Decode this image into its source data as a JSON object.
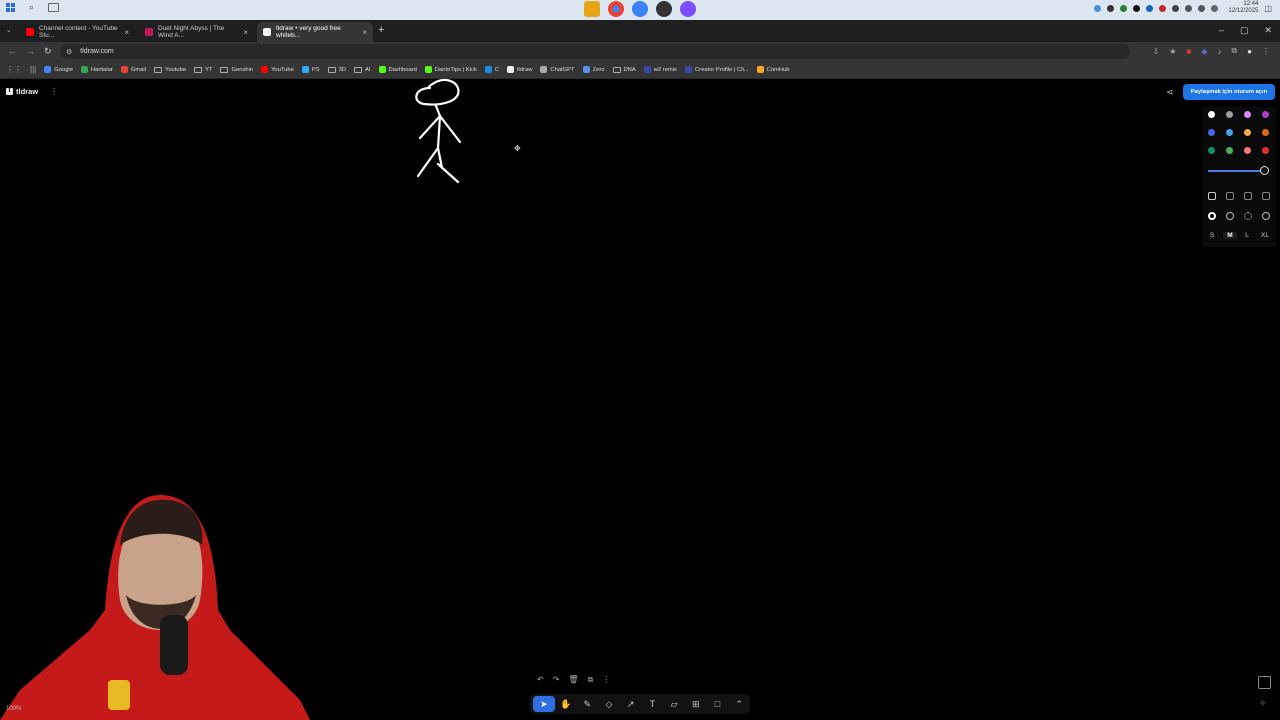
{
  "taskbar": {
    "clock_time": "12:44",
    "clock_date": "12/12/2025",
    "app_colors": [
      "#e8a317",
      "#dd4b39",
      "#3b82f6",
      "#444",
      "#7c4dff"
    ]
  },
  "tabs": [
    {
      "title": "Channel content - YouTube Stu...",
      "favicon_color": "#ff0000",
      "active": false
    },
    {
      "title": "Duet Night Abyss | The Wind A...",
      "favicon_color": "#c2185b",
      "active": false
    },
    {
      "title": "tldraw • very good free whiteb...",
      "favicon_color": "#eeeeee",
      "active": true
    }
  ],
  "address": {
    "url": "tldraw.com"
  },
  "bookmarks": [
    {
      "label": "Google",
      "icon": "google-icon",
      "color": "#4285f4"
    },
    {
      "label": "Haritalar",
      "icon": "maps-icon",
      "color": "#34a853"
    },
    {
      "label": "Gmail",
      "icon": "gmail-icon",
      "color": "#ea4335"
    },
    {
      "label": "Youtube",
      "icon": "folder-icon",
      "color": ""
    },
    {
      "label": "YT",
      "icon": "folder-icon",
      "color": ""
    },
    {
      "label": "Genshin",
      "icon": "folder-icon",
      "color": ""
    },
    {
      "label": "YouTube",
      "icon": "youtube-icon",
      "color": "#ff0000"
    },
    {
      "label": "PS",
      "icon": "ps-icon",
      "color": "#31a8ff"
    },
    {
      "label": "3D",
      "icon": "folder-icon",
      "color": ""
    },
    {
      "label": "AI",
      "icon": "folder-icon",
      "color": ""
    },
    {
      "label": "Dashboard",
      "icon": "kick-icon",
      "color": "#53fc18"
    },
    {
      "label": "DanteTips | Kick",
      "icon": "kick-icon",
      "color": "#53fc18"
    },
    {
      "label": "C",
      "icon": "c-icon",
      "color": "#1e88e5"
    },
    {
      "label": "tldraw",
      "icon": "tldraw-icon",
      "color": "#eeeeee"
    },
    {
      "label": "ChatGPT",
      "icon": "chatgpt-icon",
      "color": "#aaaaaa"
    },
    {
      "label": "Zero",
      "icon": "zero-icon",
      "color": "#5b8def"
    },
    {
      "label": "DNA",
      "icon": "folder-icon",
      "color": ""
    },
    {
      "label": "w2 remix",
      "icon": "w2-icon",
      "color": "#3949ab"
    },
    {
      "label": "Creator Profile | Cli...",
      "icon": "creator-icon",
      "color": "#3949ab"
    },
    {
      "label": "ComHub",
      "icon": "comhub-icon",
      "color": "#f9a825"
    }
  ],
  "tldraw": {
    "brand": "tldraw",
    "signin_label": "Paylaşmak için oturum açın",
    "colors": [
      "#ffffff",
      "#9e9e9e",
      "#e085f4",
      "#ae3ec9",
      "#4465e9",
      "#4ba1f1",
      "#f1ac4b",
      "#e16919",
      "#099268",
      "#4cb05e",
      "#f87777",
      "#e03131"
    ],
    "opacity": 1.0,
    "sizes": [
      "S",
      "M",
      "L",
      "XL"
    ],
    "selected_size": "M",
    "zoom": "100%"
  },
  "tools": [
    {
      "name": "select-tool",
      "glyph": "➤",
      "active": true
    },
    {
      "name": "hand-tool",
      "glyph": "✋",
      "active": false
    },
    {
      "name": "draw-tool",
      "glyph": "✎",
      "active": false
    },
    {
      "name": "eraser-tool",
      "glyph": "◇",
      "active": false
    },
    {
      "name": "arrow-tool",
      "glyph": "↗",
      "active": false
    },
    {
      "name": "text-tool",
      "glyph": "T",
      "active": false
    },
    {
      "name": "note-tool",
      "glyph": "▱",
      "active": false
    },
    {
      "name": "asset-tool",
      "glyph": "⊞",
      "active": false
    },
    {
      "name": "rectangle-tool",
      "glyph": "□",
      "active": false
    },
    {
      "name": "more-tools",
      "glyph": "⌃",
      "active": false
    }
  ]
}
